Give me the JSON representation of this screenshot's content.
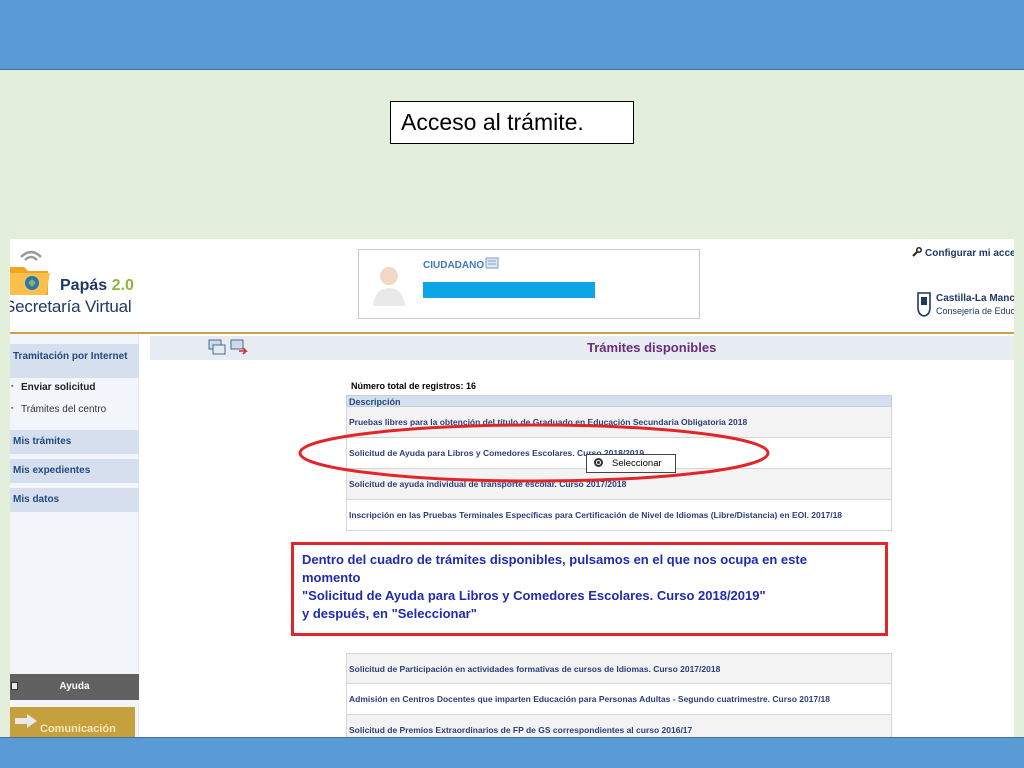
{
  "slide": {
    "title": "Acceso al trámite."
  },
  "app": {
    "brand_title": "Papás",
    "brand_version": "2.0",
    "brand_sub": "Secretaría Virtual",
    "user_role": "CIUDADANO",
    "config_link": "Configurar mi acceso",
    "org_name": "Castilla-La Mancha",
    "org_dept": "Consejería de Educación"
  },
  "sidebar": {
    "section": "Tramitación por Internet",
    "items": [
      {
        "label": "Enviar solicitud"
      },
      {
        "label": "Trámites del centro"
      }
    ],
    "links": [
      {
        "label": "Mis trámites"
      },
      {
        "label": "Mis expedientes"
      },
      {
        "label": "Mis datos"
      }
    ],
    "help": "Ayuda",
    "comm": "Comunicación"
  },
  "main": {
    "title": "Trámites disponibles",
    "total_label": "Número total de registros: 16",
    "column_header": "Descripción",
    "rows": [
      {
        "description": "Pruebas libres para la obtención del título de Graduado en Educación Secundaria Obligatoria 2018"
      },
      {
        "description": "Solicitud de Ayuda para Libros y Comedores Escolares. Curso 2018/2019"
      },
      {
        "description": "Solicitud de ayuda individual de transporte escolar. Curso 2017/2018"
      },
      {
        "description": "Inscripción en las Pruebas Terminales Específicas para Certificación de Nivel de Idiomas (Libre/Distancia) en EOI. 2017/18"
      }
    ],
    "rows_bottom": [
      {
        "description": "Solicitud de Participación en actividades formativas de cursos de Idiomas. Curso 2017/2018"
      },
      {
        "description": "Admisión en Centros Docentes que imparten Educación para Personas Adultas - Segundo cuatrimestre. Curso 2017/18"
      },
      {
        "description": "Solicitud de Premios Extraordinarios de FP de GS correspondientes al curso 2016/17"
      }
    ],
    "select_button": "Seleccionar"
  },
  "note": {
    "line1": "Dentro del cuadro de trámites disponibles, pulsamos en el que nos ocupa en este",
    "line2": "momento",
    "line3": "\"Solicitud de Ayuda para Libros y Comedores Escolares. Curso 2018/2019\"",
    "line4": "y después, en \"Seleccionar\""
  },
  "colors": {
    "band": "#5b9bd5",
    "background": "#e3efdb",
    "highlight_red": "#e0262b",
    "note_text": "#1f2bb0",
    "title_purple": "#6b2d75"
  }
}
